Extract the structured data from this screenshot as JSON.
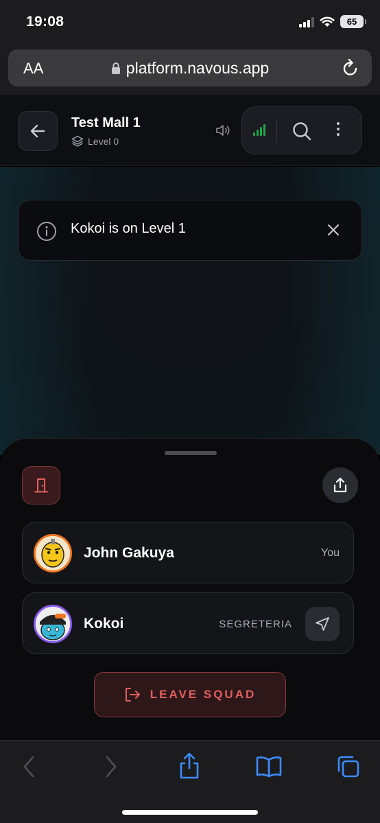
{
  "status_bar": {
    "time": "19:08",
    "battery": "65"
  },
  "browser": {
    "text_size_label": "AA",
    "url": "platform.navous.app"
  },
  "header": {
    "title": "Test Mall 1",
    "level": "Level 0"
  },
  "notice": {
    "message": "Kokoi is on Level 1"
  },
  "members": [
    {
      "name": "John Gakuya",
      "tag": "You",
      "avatar_color": "#f07722"
    },
    {
      "name": "Kokoi",
      "location": "SEGRETERIA",
      "avatar_color": "#8a5df0"
    }
  ],
  "actions": {
    "leave_label": "LEAVE SQUAD"
  },
  "colors": {
    "accent_red": "#e0605f",
    "signal_green": "#22a447",
    "safari_blue": "#3d8bff"
  },
  "icons": [
    "back-arrow-icon",
    "layers-icon",
    "speaker-icon",
    "signal-icon",
    "search-icon",
    "more-icon",
    "info-icon",
    "close-icon",
    "door-icon",
    "share-icon",
    "navigate-icon",
    "exit-icon"
  ]
}
